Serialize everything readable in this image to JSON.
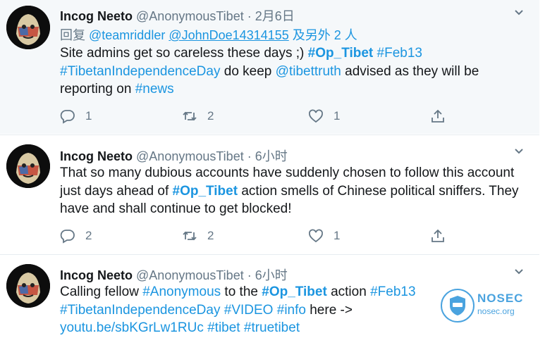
{
  "colors": {
    "link": "#1b95e0",
    "muted": "#657786",
    "text": "#14171a",
    "highlight_bg": "#f5f8fa"
  },
  "tweets": [
    {
      "name": "Incog Neeto",
      "handle": "@AnonymousTibet",
      "sep": "·",
      "time": "2月6日",
      "reply": {
        "prefix": "回复",
        "user1": "@teamriddler",
        "user2": "@JohnDoe14314155",
        "suffix": "及另外 2 人"
      },
      "text": {
        "p1": "Site admins get so careless these days ;) ",
        "tag_op": "#Op_Tibet",
        "tag_feb": "#Feb13",
        "tag_day": "#TibetanIndependenceDay",
        "p2": " do keep ",
        "mention": "@tibettruth",
        "p3": " advised as they will be reporting on ",
        "tag_news": "#news"
      },
      "replies": "1",
      "retweets": "2",
      "likes": "1"
    },
    {
      "name": "Incog Neeto",
      "handle": "@AnonymousTibet",
      "sep": "·",
      "time": "6小时",
      "text": {
        "p1": "That so many dubious accounts have suddenly chosen to follow this account just days ahead of ",
        "tag_op": "#Op_Tibet",
        "p2": " action smells of Chinese political sniffers. They have and shall continue to get blocked!"
      },
      "replies": "2",
      "retweets": "2",
      "likes": "1"
    },
    {
      "name": "Incog Neeto",
      "handle": "@AnonymousTibet",
      "sep": "·",
      "time": "6小时",
      "text": {
        "p1": "Calling fellow ",
        "tag_anon": "#Anonymous",
        "p2": " to the ",
        "tag_op": "#Op_Tibet",
        "p3": " action ",
        "tag_feb": "#Feb13",
        "tag_day": "#TibetanIndependenceDay",
        "tag_video": "#VIDEO",
        "tag_info": "#info",
        "p4": " here -> ",
        "link": "youtu.be/sbKGrLw1RUc",
        "tag_tibet": "#tibet",
        "tag_truetibet": "#truetibet"
      }
    }
  ],
  "watermark": {
    "title": "NOSEC",
    "sub": "nosec.org"
  }
}
